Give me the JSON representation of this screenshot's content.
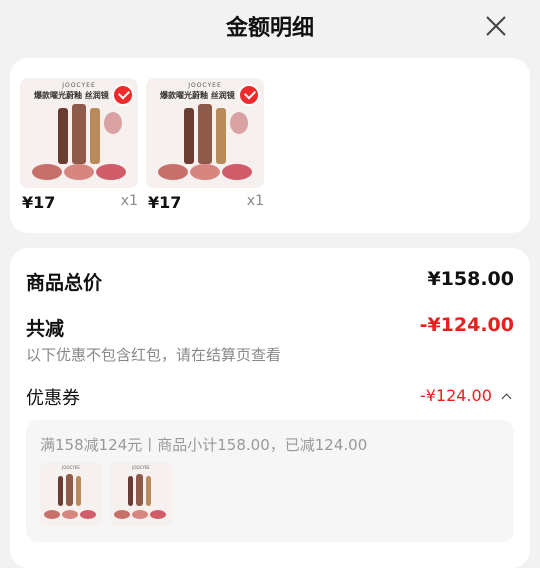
{
  "header": {
    "title": "金额明细",
    "close_icon": "close-icon"
  },
  "items": [
    {
      "brand": "JOOCYEE",
      "tag": "爆款曜光蔚釉 丝润镜",
      "price": "¥17",
      "qty": "x1",
      "selected": true
    },
    {
      "brand": "JOOCYEE",
      "tag": "爆款曜光蔚釉 丝润镜",
      "price": "¥17",
      "qty": "x1",
      "selected": true
    }
  ],
  "summary": {
    "total_label": "商品总价",
    "total_value": "¥158.00",
    "discount_label": "共减",
    "discount_value": "-¥124.00",
    "note": "以下优惠不包含红包，请在结算页查看",
    "coupon_label": "优惠券",
    "coupon_value": "-¥124.00",
    "coupon_detail": "满158减124元丨商品小计158.00，已减124.00"
  },
  "colors": {
    "accent": "#e6211e",
    "check": "#ee2a2a"
  }
}
